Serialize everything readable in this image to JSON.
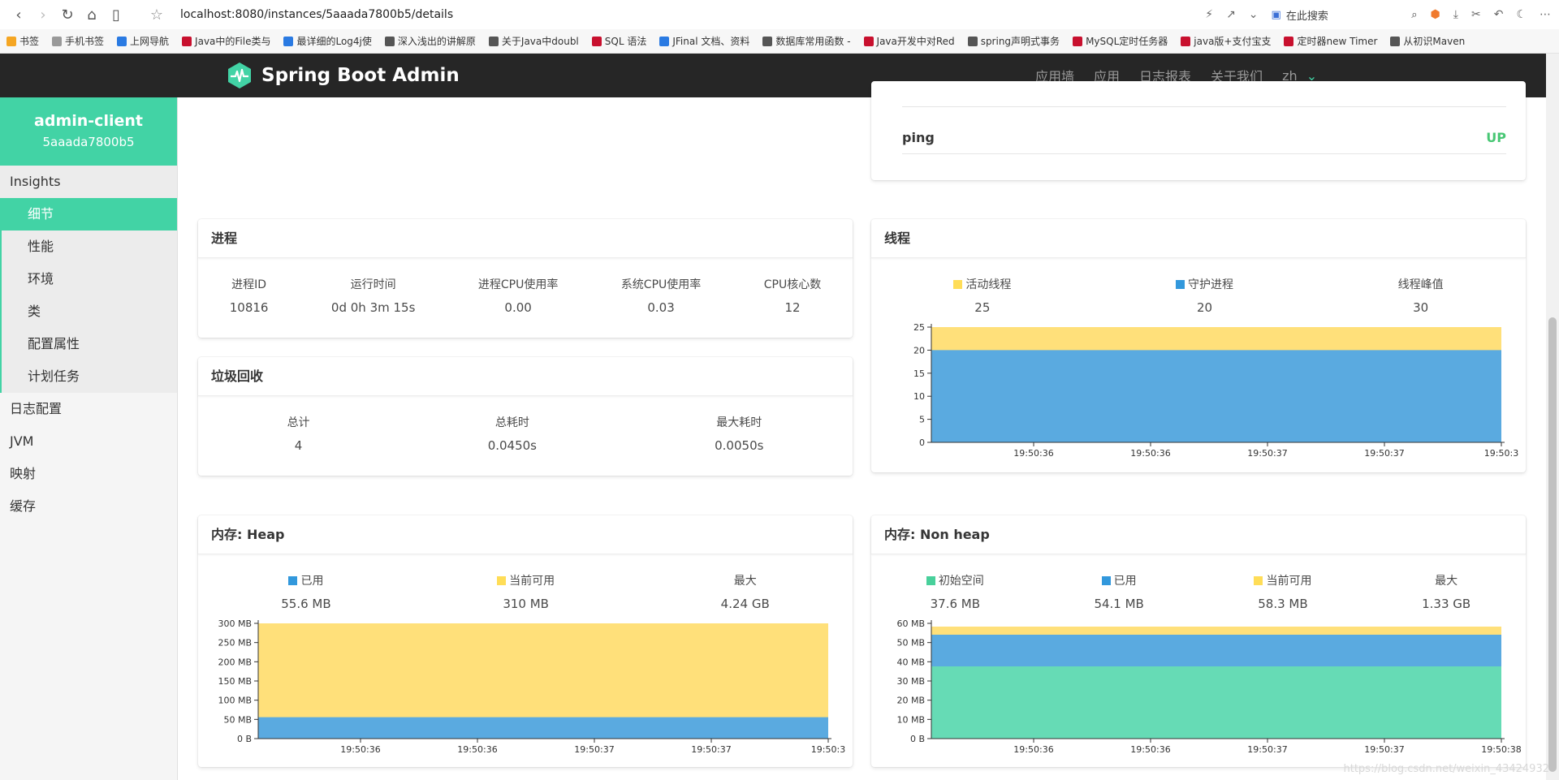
{
  "browser": {
    "url": "localhost:8080/instances/5aaada7800b5/details",
    "search_placeholder": "在此搜索",
    "bookmarks": [
      "书签",
      "手机书签",
      "上网导航",
      "Java中的File类与",
      "最详细的Log4j使",
      "深入浅出的讲解原",
      "关于Java中doubl",
      "SQL 语法",
      "JFinal 文档、资料",
      "数据库常用函数 -",
      "Java开发中对Red",
      "spring声明式事务",
      "MySQL定时任务器",
      "java版+支付宝支",
      "定时器new Timer",
      "从初识Maven"
    ]
  },
  "navbar": {
    "brand": "Spring Boot Admin",
    "links": [
      "应用墙",
      "应用",
      "日志报表",
      "关于我们",
      "zh"
    ]
  },
  "sidebar": {
    "app_name": "admin-client",
    "instance_id": "5aaada7800b5",
    "group": "Insights",
    "sub_items": [
      "细节",
      "性能",
      "环境",
      "类",
      "配置属性",
      "计划任务"
    ],
    "items": [
      "日志配置",
      "JVM",
      "映射",
      "缓存"
    ]
  },
  "health": {
    "name": "ping",
    "status": "UP"
  },
  "process": {
    "title": "进程",
    "stats": [
      {
        "label": "进程ID",
        "value": "10816"
      },
      {
        "label": "运行时间",
        "value": "0d 0h 3m 15s"
      },
      {
        "label": "进程CPU使用率",
        "value": "0.00"
      },
      {
        "label": "系统CPU使用率",
        "value": "0.03"
      },
      {
        "label": "CPU核心数",
        "value": "12"
      }
    ]
  },
  "gc": {
    "title": "垃圾回收",
    "stats": [
      {
        "label": "总计",
        "value": "4"
      },
      {
        "label": "总耗时",
        "value": "0.0450s"
      },
      {
        "label": "最大耗时",
        "value": "0.0050s"
      }
    ]
  },
  "threads": {
    "title": "线程",
    "stats": [
      {
        "label": "活动线程",
        "value": "25",
        "color": "#ffdd57"
      },
      {
        "label": "守护进程",
        "value": "20",
        "color": "#3298dc"
      },
      {
        "label": "线程峰值",
        "value": "30",
        "color": ""
      }
    ]
  },
  "heap": {
    "title": "内存: Heap",
    "stats": [
      {
        "label": "已用",
        "value": "55.6 MB",
        "color": "#3298dc"
      },
      {
        "label": "当前可用",
        "value": "310 MB",
        "color": "#ffdd57"
      },
      {
        "label": "最大",
        "value": "4.24 GB",
        "color": ""
      }
    ]
  },
  "nonheap": {
    "title": "内存: Non heap",
    "stats": [
      {
        "label": "初始空间",
        "value": "37.6 MB",
        "color": "#48d09b"
      },
      {
        "label": "已用",
        "value": "54.1 MB",
        "color": "#3298dc"
      },
      {
        "label": "当前可用",
        "value": "58.3 MB",
        "color": "#ffdd57"
      },
      {
        "label": "最大",
        "value": "1.33 GB",
        "color": ""
      }
    ]
  },
  "chart_data": [
    {
      "type": "area",
      "name": "threads",
      "x": [
        "19:50:36",
        "19:50:36",
        "19:50:37",
        "19:50:37",
        "19:50:3"
      ],
      "ylim": [
        0,
        25
      ],
      "yticks": [
        "0",
        "5",
        "10",
        "15",
        "20",
        "25"
      ],
      "series": [
        {
          "name": "守护进程",
          "values": [
            20,
            20,
            20,
            20,
            20
          ],
          "color": "#5aaae0"
        },
        {
          "name": "活动线程",
          "values": [
            25,
            25,
            25,
            25,
            25
          ],
          "color": "#ffe07a"
        }
      ]
    },
    {
      "type": "area",
      "name": "heap",
      "x": [
        "19:50:36",
        "19:50:36",
        "19:50:37",
        "19:50:37",
        "19:50:3"
      ],
      "ylim": [
        0,
        300
      ],
      "yticks": [
        "0 B",
        "50 MB",
        "100 MB",
        "150 MB",
        "200 MB",
        "250 MB",
        "300 MB"
      ],
      "series": [
        {
          "name": "已用",
          "values": [
            55.6,
            55.6,
            55.6,
            55.6,
            55.6
          ],
          "color": "#5aaae0"
        },
        {
          "name": "当前可用",
          "values": [
            310,
            310,
            310,
            310,
            310
          ],
          "color": "#ffe07a"
        }
      ]
    },
    {
      "type": "area",
      "name": "nonheap",
      "x": [
        "19:50:36",
        "19:50:36",
        "19:50:37",
        "19:50:37",
        "19:50:38"
      ],
      "ylim": [
        0,
        60
      ],
      "yticks": [
        "0 B",
        "10 MB",
        "20 MB",
        "30 MB",
        "40 MB",
        "50 MB",
        "60 MB"
      ],
      "series": [
        {
          "name": "初始空间",
          "values": [
            37.6,
            37.6,
            37.6,
            37.6,
            37.6
          ],
          "color": "#66dbb5"
        },
        {
          "name": "已用",
          "values": [
            54.1,
            54.1,
            54.1,
            54.1,
            54.1
          ],
          "color": "#5aaae0"
        },
        {
          "name": "当前可用",
          "values": [
            58.3,
            58.3,
            58.3,
            58.3,
            58.3
          ],
          "color": "#ffe07a"
        }
      ]
    }
  ],
  "watermark": "https://blog.csdn.net/weixin_43424932"
}
